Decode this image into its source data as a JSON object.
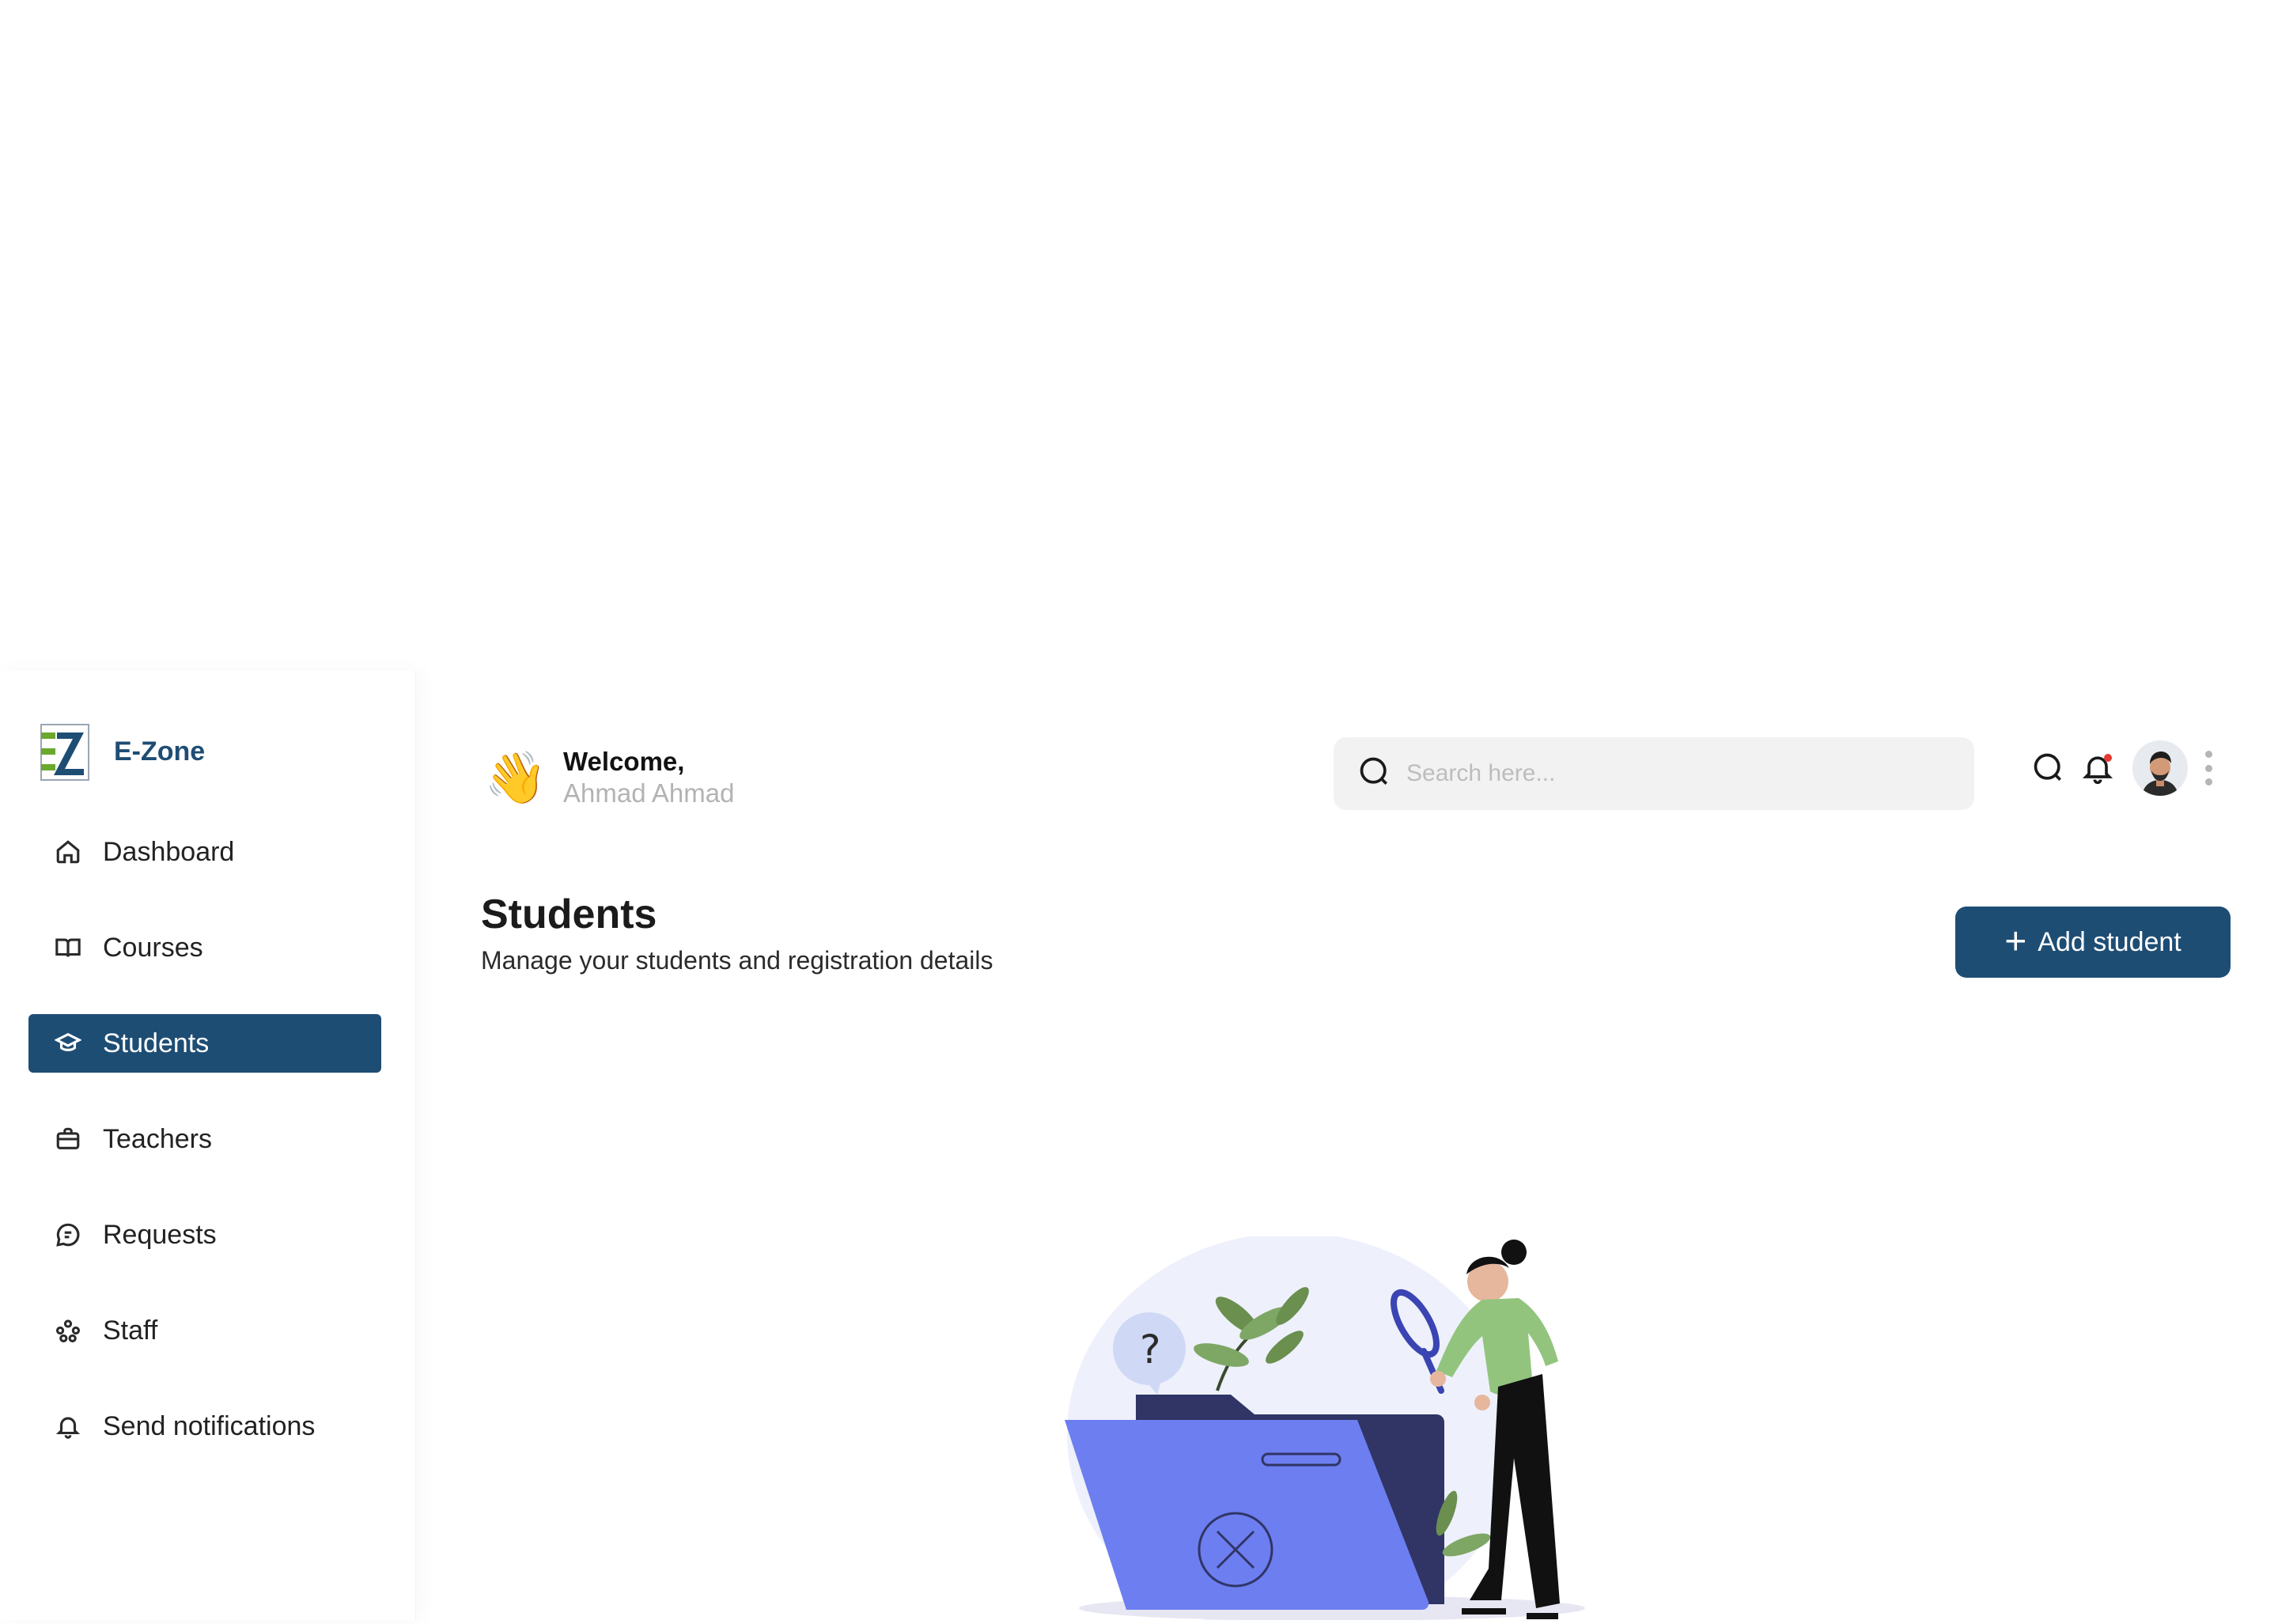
{
  "brand": {
    "name": "E-Zone",
    "logo_icon": "ez-logo-icon",
    "colors": {
      "primary": "#1e4d74",
      "logo_green": "#6aa82e"
    }
  },
  "sidebar": {
    "items": [
      {
        "label": "Dashboard",
        "icon": "home-icon",
        "active": false
      },
      {
        "label": "Courses",
        "icon": "book-icon",
        "active": false
      },
      {
        "label": "Students",
        "icon": "graduation-cap-icon",
        "active": true
      },
      {
        "label": "Teachers",
        "icon": "briefcase-icon",
        "active": false
      },
      {
        "label": "Requests",
        "icon": "chat-icon",
        "active": false
      },
      {
        "label": "Staff",
        "icon": "team-icon",
        "active": false
      },
      {
        "label": "Send notifications",
        "icon": "bell-icon",
        "active": false
      }
    ]
  },
  "header": {
    "welcome_label": "Welcome,",
    "user_name": "Ahmad Ahmad",
    "search_placeholder": "Search here...",
    "icons": [
      "search-icon",
      "notification-bell-icon",
      "avatar",
      "more-vertical-icon"
    ]
  },
  "page": {
    "title": "Students",
    "subtitle": "Manage your students and registration details",
    "add_button_label": "Add student",
    "add_button_icon": "plus-icon"
  },
  "empty_state": {
    "illustration": "empty-folder-search-illustration"
  }
}
